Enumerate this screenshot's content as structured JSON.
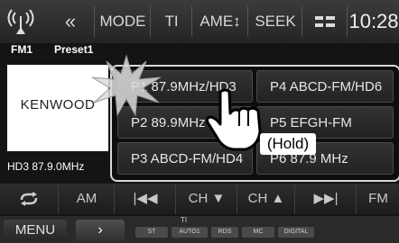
{
  "topbar": {
    "antenna_icon": "antenna-icon",
    "back_label": "«",
    "mode_label": "MODE",
    "ti_label": "TI",
    "ame_label": "AME↕",
    "seek_label": "SEEK",
    "menu_icon": "list-menu-icon",
    "clock": "10:28"
  },
  "info": {
    "band": "FM1",
    "preset": "Preset1",
    "hd_status": "HD3  87.9.0MHz"
  },
  "logo": {
    "text": "KENWOOD"
  },
  "presets": [
    {
      "label": "P1 87.9MHz/HD3"
    },
    {
      "label": "P2 89.9MHz"
    },
    {
      "label": "P3 ABCD-FM/HD4"
    },
    {
      "label": "P4 ABCD-FM/HD6"
    },
    {
      "label": "P5 EFGH-FM"
    },
    {
      "label": "P6 87.9 MHz"
    }
  ],
  "hint": {
    "hold_label": "(Hold)"
  },
  "controls": {
    "repeat_icon": "repeat-icon",
    "am_label": "AM",
    "prev_label": "|◀◀",
    "ch_down_label": "CH ▼",
    "ch_up_label": "CH ▲",
    "next_label": "▶▶|",
    "fm_label": "FM"
  },
  "bottom": {
    "menu_label": "MENU",
    "arrow_label": "›",
    "ti_label": "TI",
    "indicators": [
      "ST",
      "AUTO1",
      "RDS",
      "MC",
      "DIGITAL"
    ]
  },
  "colors": {
    "background": "#141414",
    "panel_border": "#d9d9d9",
    "hold_bg": "#ffffff"
  }
}
